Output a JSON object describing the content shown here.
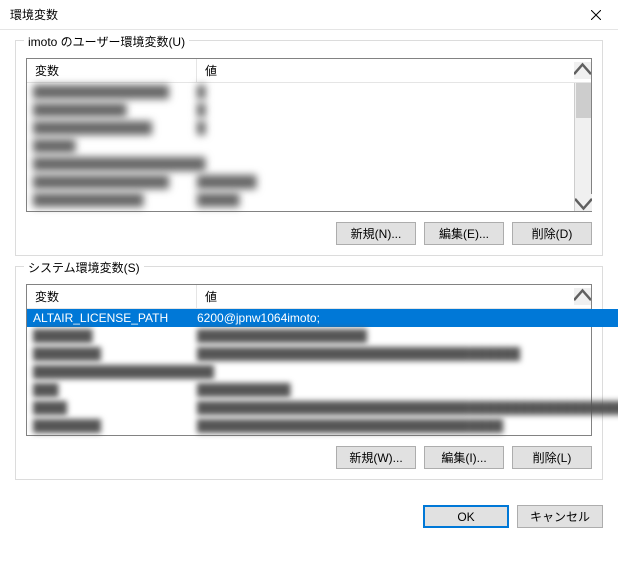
{
  "dialog": {
    "title": "環境変数"
  },
  "user_section": {
    "legend": "imoto のユーザー環境変数(U)",
    "col_var": "変数",
    "col_val": "値",
    "new_btn": "新規(N)...",
    "edit_btn": "編集(E)...",
    "del_btn": "削除(D)"
  },
  "system_section": {
    "legend": "システム環境変数(S)",
    "col_var": "変数",
    "col_val": "値",
    "selected_var": "ALTAIR_LICENSE_PATH",
    "selected_val": "6200@jpnw1064imoto;",
    "new_btn": "新規(W)...",
    "edit_btn": "編集(I)...",
    "del_btn": "削除(L)"
  },
  "buttons": {
    "ok": "OK",
    "cancel": "キャンセル"
  }
}
